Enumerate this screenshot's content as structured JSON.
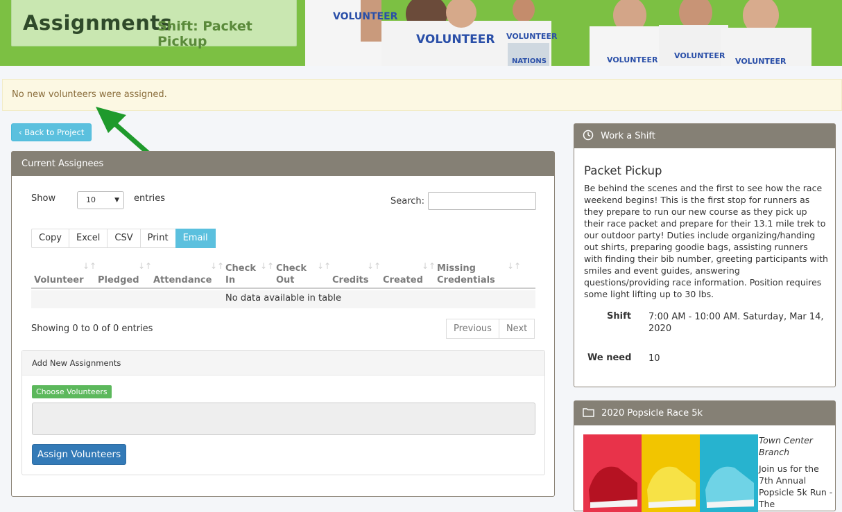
{
  "header": {
    "title": "Assignments",
    "subtitle": "Shift: Packet Pickup"
  },
  "alert": {
    "message": "No new volunteers were assigned."
  },
  "back_button": {
    "label": "Back to Project"
  },
  "assignees": {
    "panel_title": "Current Assignees",
    "show_label": "Show",
    "page_size": "10",
    "entries_label": "entries",
    "search_label": "Search:",
    "search_value": "",
    "export_buttons": [
      "Copy",
      "Excel",
      "CSV",
      "Print",
      "Email"
    ],
    "active_export": "Email",
    "columns": [
      {
        "line1": "",
        "line2": "Volunteer"
      },
      {
        "line1": "",
        "line2": "Pledged"
      },
      {
        "line1": "",
        "line2": "Attendance"
      },
      {
        "line1": "Check",
        "line2": "In"
      },
      {
        "line1": "Check",
        "line2": "Out"
      },
      {
        "line1": "",
        "line2": "Credits"
      },
      {
        "line1": "",
        "line2": "Created"
      },
      {
        "line1": "Missing",
        "line2": "Credentials"
      }
    ],
    "empty_message": "No data available in table",
    "info": "Showing 0 to 0 of 0 entries",
    "previous_label": "Previous",
    "next_label": "Next"
  },
  "add_assignments": {
    "title": "Add New Assignments",
    "choose_label": "Choose Volunteers",
    "textarea_value": "",
    "assign_label": "Assign Volunteers"
  },
  "work_shift": {
    "panel_title": "Work a Shift",
    "name": "Packet Pickup",
    "description": "Be behind the scenes and the first to see how the race weekend begins! This is the first stop for runners as they prepare to run our new course as they pick up their race packet and prepare for their 13.1 mile trek to our outdoor party! Duties include organizing/handing out shirts, preparing goodie bags, assisting runners with finding their bib number, greeting participants with smiles and event guides, answering questions/providing race information. Position requires some light lifting up to 30 lbs.",
    "shift_label": "Shift",
    "shift_value": "7:00 AM - 10:00 AM. Saturday, Mar 14, 2020",
    "need_label": "We need",
    "need_value": "10"
  },
  "project": {
    "panel_title": "2020 Popsicle Race 5k",
    "branch": "Town Center Branch",
    "blurb": "Join us for the 7th Annual Popsicle 5k Run - The"
  },
  "colors": {
    "banner_green": "#7cc043",
    "info_blue": "#5bc0de",
    "primary_blue": "#337ab7",
    "success_green": "#5cb85c",
    "panel_head": "#858075",
    "arrow_green": "#1f9a2c"
  }
}
